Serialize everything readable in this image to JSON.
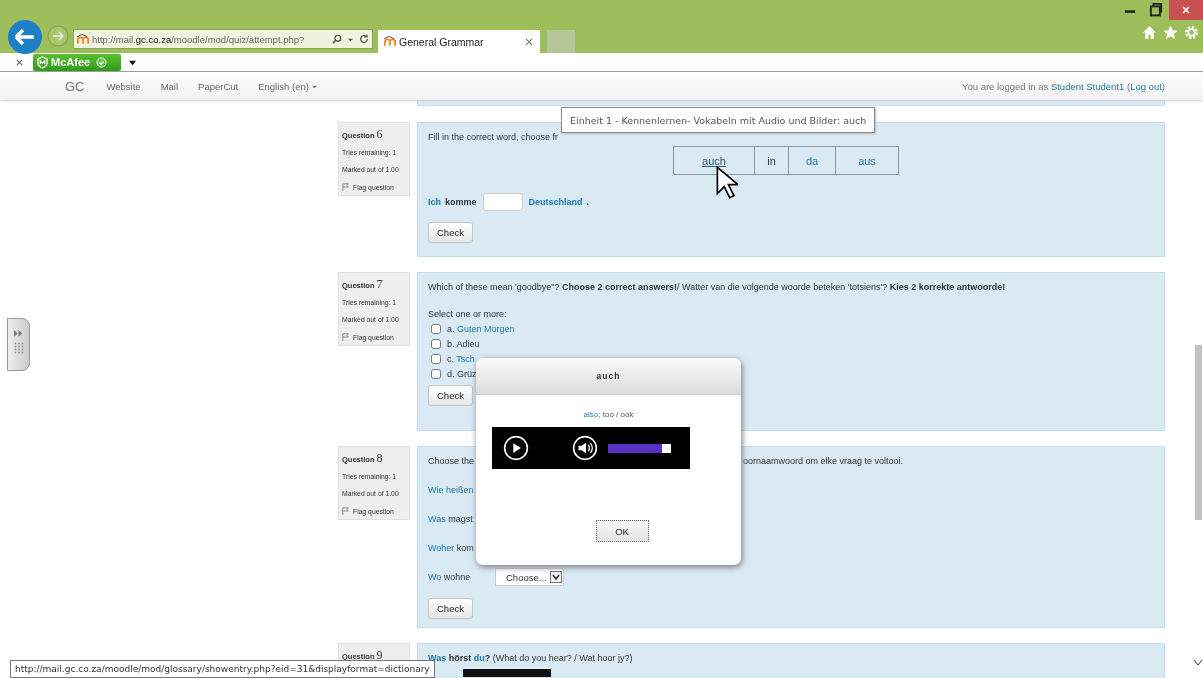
{
  "browser": {
    "address": "http://mail.**gc.co.za**/moodle/mod/quiz/attempt.php?",
    "tabs": [
      {
        "title": "General Grammar",
        "selected": true
      }
    ],
    "addon": "McAfee"
  },
  "site_nav": {
    "brand": "GC",
    "links": [
      {
        "label": "Website",
        "kind": "link"
      },
      {
        "label": "Mail",
        "kind": "link"
      },
      {
        "label": "PaperCut",
        "kind": "link"
      },
      {
        "label": "English (en)",
        "kind": "menu"
      }
    ],
    "login": [
      {
        "text": "You are logged in as "
      },
      {
        "text": "Student Student1",
        "link": true
      },
      {
        "text": " ("
      },
      {
        "text": "Log out",
        "link": true
      },
      {
        "text": ")"
      }
    ]
  },
  "questions": [
    {
      "kind": "drag-words",
      "label": "Question",
      "number": "6",
      "info": [
        "Tries remaining: 1",
        "Marked out of 1.00"
      ],
      "flag": "Flag question",
      "prompt": "Fill in the correct word, choose fr",
      "word_bank": [
        {
          "text": "auch",
          "link": true,
          "hovered": true
        },
        {
          "text": "in",
          "link": false,
          "hovered": false
        },
        {
          "text": "da",
          "link": true,
          "hovered": false
        },
        {
          "text": "aus",
          "link": true,
          "hovered": false
        }
      ],
      "sentence": [
        {
          "text": "Ich",
          "link": true
        },
        {
          "text": "komme"
        },
        {
          "kind": "gap"
        },
        {
          "text": "Deutschland",
          "link": true
        },
        {
          "text": "."
        }
      ],
      "check": "Check"
    },
    {
      "kind": "multi-choice",
      "label": "Question",
      "number": "7",
      "info": [
        "Tries remaining: 1",
        "Marked out of 1.00"
      ],
      "flag": "Flag question",
      "prompt": "Which of these mean 'goodbye\"?  **Choose 2 correct answers!**/ Watter van die volgende woorde beteken 'totsiens'? **Kies 2 korrekte antwoorde!**",
      "instruction": "Select one or more:",
      "options": [
        {
          "letter": "a.",
          "segments": [
            {
              "text": "Guten Morgen",
              "link": true
            }
          ],
          "checked": false
        },
        {
          "letter": "b.",
          "segments": [
            {
              "text": "Adieu"
            }
          ],
          "checked": false
        },
        {
          "letter": "c.",
          "segments": [
            {
              "text": "Tsch",
              "link": true
            }
          ],
          "checked": false
        },
        {
          "letter": "d.",
          "segments": [
            {
              "text": "Grüz"
            }
          ],
          "checked": false
        }
      ],
      "check": "Check"
    },
    {
      "kind": "select-rows",
      "label": "Question",
      "number": "8",
      "info": [
        "Tries remaining: 1",
        "Marked out of 1.00"
      ],
      "flag": "Flag question",
      "prompt_parts": [
        "Choose the",
        "oornaamwoord om elke vraag te voltooi."
      ],
      "rows": [
        {
          "segments": [
            {
              "text": "Wie heißen",
              "link": true
            }
          ]
        },
        {
          "segments": [
            {
              "text": "Was",
              "link": true
            },
            {
              "text": " magst"
            }
          ]
        },
        {
          "segments": [
            {
              "text": "Woher",
              "link": true
            },
            {
              "text": " kom"
            }
          ]
        },
        {
          "segments": [
            {
              "text": "Wo",
              "link": true
            },
            {
              "text": " wohne"
            }
          ],
          "select": "Choose..."
        }
      ],
      "check": "Check"
    },
    {
      "kind": "audio",
      "label": "Question",
      "number": "9",
      "segments": [
        {
          "text": "Was",
          "link": true,
          "bold": true
        },
        {
          "text": " **hörst** "
        },
        {
          "text": "du",
          "link": true,
          "bold": true
        },
        {
          "text": "**?** (What do you hear? / Wat hoor jy?)"
        }
      ]
    }
  ],
  "tooltip": "Einheit 1 - Kennenlernen- Vokabeln mit Audio und Bilder: auch",
  "dialog": {
    "title": "auch",
    "definition": [
      {
        "text": "also",
        "link": true
      },
      {
        "text": "; too / ook"
      }
    ],
    "player": {
      "level": 0.86
    },
    "ok": "OK"
  },
  "status_url": "http://mail.gc.co.za/moodle/mod/glossary/showentry.php?eid=31&displayformat=dictionary"
}
